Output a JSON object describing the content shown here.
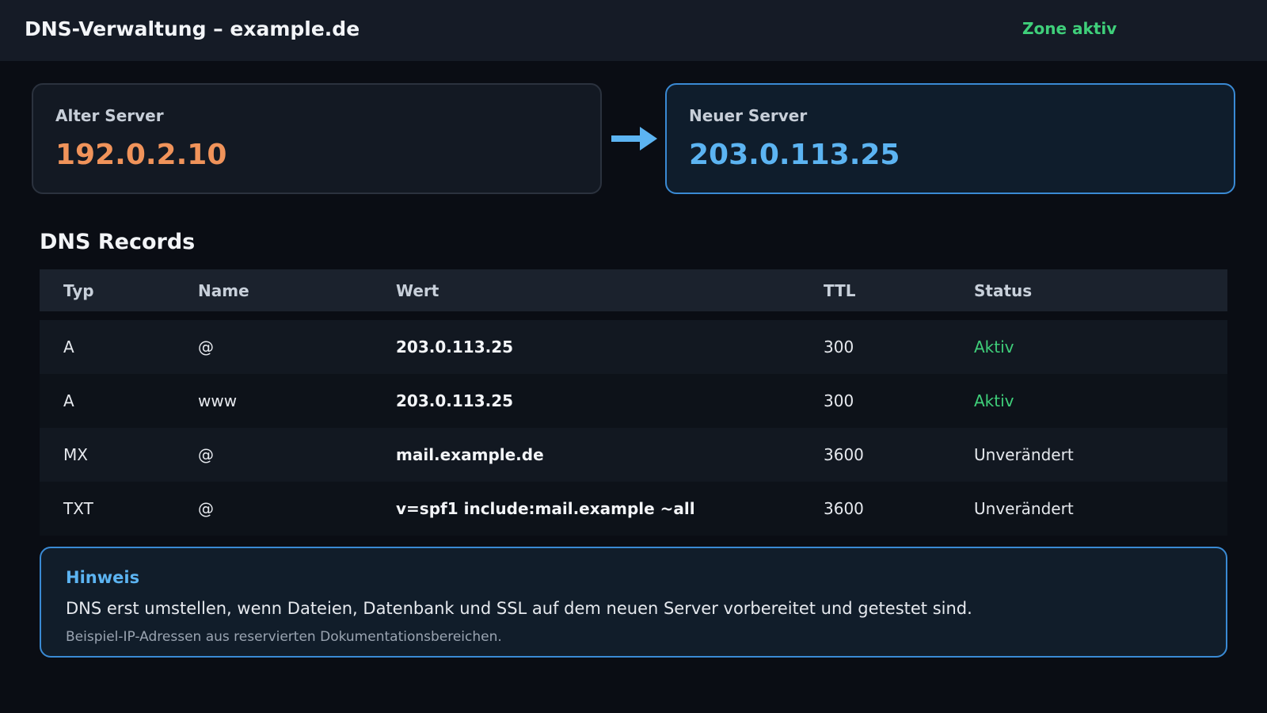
{
  "header": {
    "title": "DNS-Verwaltung – example.de",
    "zone_status": "Zone aktiv"
  },
  "migration": {
    "old": {
      "label": "Alter Server",
      "ip": "192.0.2.10"
    },
    "new": {
      "label": "Neuer Server",
      "ip": "203.0.113.25"
    },
    "arrow_icon": "arrow-right-icon"
  },
  "records": {
    "title": "DNS Records",
    "columns": [
      "Typ",
      "Name",
      "Wert",
      "TTL",
      "Status"
    ],
    "rows": [
      {
        "type": "A",
        "name": "@",
        "value": "203.0.113.25",
        "ttl": "300",
        "status": "Aktiv",
        "status_kind": "active"
      },
      {
        "type": "A",
        "name": "www",
        "value": "203.0.113.25",
        "ttl": "300",
        "status": "Aktiv",
        "status_kind": "active"
      },
      {
        "type": "MX",
        "name": "@",
        "value": "mail.example.de",
        "ttl": "3600",
        "status": "Unverändert",
        "status_kind": "unchanged"
      },
      {
        "type": "TXT",
        "name": "@",
        "value": "v=spf1 include:mail.example ~all",
        "ttl": "3600",
        "status": "Unverändert",
        "status_kind": "unchanged"
      }
    ]
  },
  "hint": {
    "title": "Hinweis",
    "text": "DNS erst umstellen, wenn Dateien, Datenbank und SSL auf dem neuen Server vorbereitet und getestet sind.",
    "note": "Beispiel-IP-Adressen aus reservierten Dokumentationsbereichen."
  },
  "colors": {
    "background": "#0a0d14",
    "active": "#3fcf7a",
    "old_ip": "#f0935a",
    "new_ip": "#5cb4f2",
    "accent_border": "#3a8ad4"
  }
}
